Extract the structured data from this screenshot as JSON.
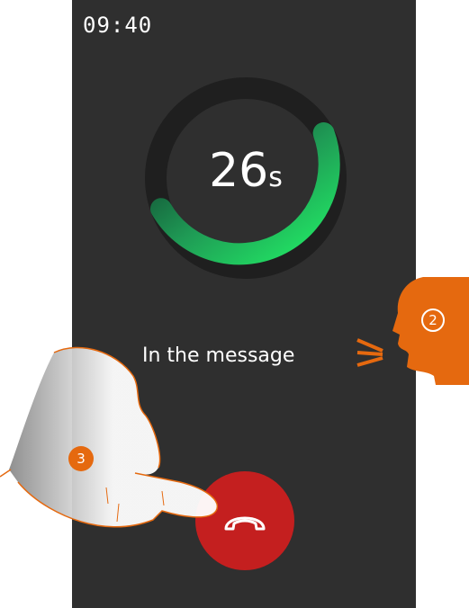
{
  "status_bar": {
    "time": "09:40"
  },
  "call": {
    "timer_value": "26",
    "timer_unit": "s",
    "timer_progress": 0.72,
    "message": "In the message"
  },
  "annotations": {
    "speak_step": "2",
    "tap_step": "3"
  },
  "colors": {
    "screen_bg": "#2f2f2f",
    "ring_track": "#1f1f1f",
    "ring_progress": "#22dd66",
    "end_call": "#c41f1f",
    "annotation": "#e5690f"
  },
  "icons": {
    "end_call": "phone-hangup-icon",
    "speaker_head": "speaking-head-icon",
    "pointer": "pointing-hand-icon"
  }
}
